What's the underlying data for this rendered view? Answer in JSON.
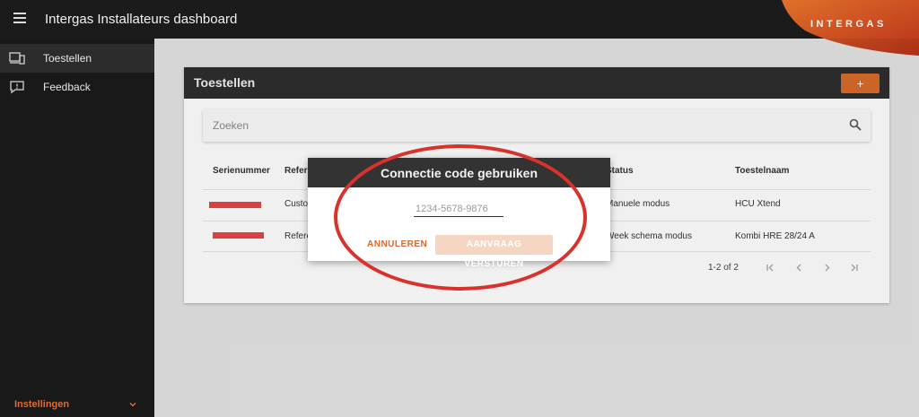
{
  "header": {
    "title": "Intergas Installateurs dashboard",
    "brand": "INTERGAS",
    "brand_color": "#d86b2a"
  },
  "sidebar": {
    "items": [
      {
        "label": "Toestellen",
        "icon": "devices-icon",
        "active": true
      },
      {
        "label": "Feedback",
        "icon": "feedback-icon",
        "active": false
      }
    ],
    "settings_label": "Instellingen"
  },
  "main": {
    "card_title": "Toestellen",
    "add_label": "+",
    "search_placeholder": "Zoeken",
    "columns": [
      "Serienummer",
      "Refere",
      "Status",
      "Toestelnaam"
    ],
    "rows": [
      {
        "serial": "[redacted]",
        "reference": "Custo",
        "status": "Manuele modus",
        "name": "HCU Xtend"
      },
      {
        "serial": "[redacted]",
        "reference": "Refere",
        "status": "Week schema modus",
        "name": "Kombi HRE 28/24 A"
      }
    ],
    "pagination": "1-2 of 2"
  },
  "dialog": {
    "title": "Connectie code gebruiken",
    "input_placeholder": "1234-5678-9876",
    "input_value": "",
    "cancel_label": "ANNULEREN",
    "send_label": "AANVRAAG VERSTUREN"
  }
}
